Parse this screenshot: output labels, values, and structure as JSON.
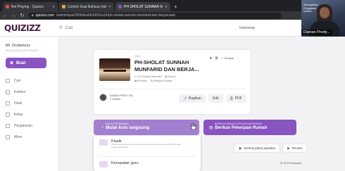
{
  "browser": {
    "tabs": [
      {
        "label": "Bot Playing · Quizizz",
        "color": "#e04b4b",
        "active": false
      },
      {
        "label": "Contoh Soal Bahasa Indonesia K",
        "color": "#e8a03c",
        "active": false
      },
      {
        "label": "PH SHOLAT SUNNAH MUNFARID",
        "color": "#8854c0",
        "active": true
      }
    ],
    "url_host": "quizizz.com",
    "url_path": "/admin/quiz/5f2b9ea6b2d001a14/ph-sholat-sunnah-munfarid-dan-berjamaah"
  },
  "header": {
    "logo": "QUIZIZZ",
    "search_placeholder": "Cari",
    "language": "Indonesia"
  },
  "webcam": {
    "overlay_text": "Menampilkan Pengajaran Quizizz",
    "name_tag": "Daman Predy..."
  },
  "sidebar": {
    "user_name": "Mr. Dcdamzzz",
    "user_sub": "MEDIA MENGAJAR KREATIF",
    "create_label": "Buat",
    "items": [
      {
        "label": "Cari",
        "icon": "search-icon"
      },
      {
        "label": "Koleksi",
        "icon": "folder-icon"
      },
      {
        "label": "Hasil",
        "icon": "chart-icon"
      },
      {
        "label": "Kelas",
        "icon": "class-icon"
      },
      {
        "label": "Pengaturan",
        "icon": "gear-icon"
      },
      {
        "label": "More",
        "icon": "more-icon"
      }
    ]
  },
  "quiz": {
    "type": "QUIZ",
    "title": "PH-SHOLAT SUNNAH MUNFARID DAN BERJA...",
    "meta_questions": "27% Muncul lebih dari",
    "meta_level": "Kelas 1",
    "meta_grades": "All Kelas",
    "meta_subject": "Religious Studies",
    "save_label": "Simpan",
    "creator_name": "DAMAN PREDY SSI...",
    "creator_time": "2 minutes",
    "share_label": "Bagikan",
    "edit_label": "Edit",
    "pdf_label": "PDF"
  },
  "assign": {
    "live_small": "MULAI PERMAINAN",
    "live_label": "Mulai kuis langsung",
    "hw_small": "BERIKAN SEBAGAI PEKERJAAN RUMAH",
    "hw_label": "Berikan Pekerjaan Rumah"
  },
  "dropdown": {
    "options": [
      {
        "title": "Klasik",
        "desc": "Siswa mengerjakan pertanyaan dengan kecepatan mereka sendiri dengan mode leaderboard"
      },
      {
        "title": "Kecepatan guru",
        "desc": "Guru mengendalikan alur dan siswa menjawab bersama"
      }
    ]
  },
  "controls": {
    "show_answers": "Sembunyikan jawaban",
    "preview": "Review",
    "count": "10 Pertanyaan"
  }
}
